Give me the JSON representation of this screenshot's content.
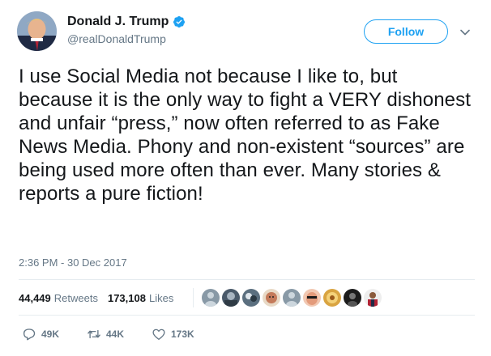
{
  "user": {
    "display_name": "Donald J. Trump",
    "handle": "@realDonaldTrump",
    "verified": true
  },
  "follow_button": {
    "label": "Follow"
  },
  "tweet": {
    "text": "I use Social Media not because I like to, but because it is the only way to fight a VERY dishonest and unfair “press,” now often referred to as Fake News Media. Phony and non-existent “sources” are being used more often than ever. Many stories & reports a pure fiction!",
    "timestamp": "2:36 PM - 30 Dec 2017"
  },
  "stats": {
    "retweets_count": "44,449",
    "retweets_label": "Retweets",
    "likes_count": "173,108",
    "likes_label": "Likes"
  },
  "actions": {
    "reply_count": "49K",
    "retweet_count": "44K",
    "like_count": "173K"
  },
  "colors": {
    "accent": "#1da1f2",
    "secondary_text": "#657786",
    "divider": "#e6ecf0"
  }
}
